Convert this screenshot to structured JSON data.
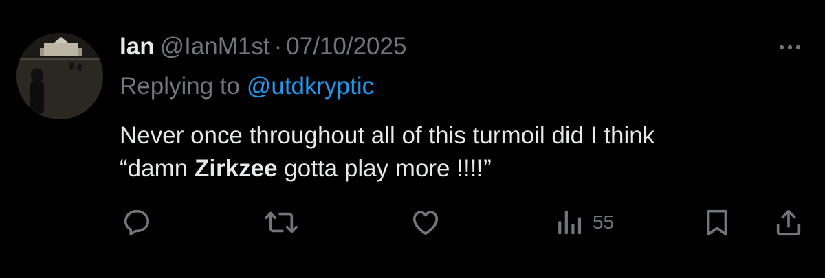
{
  "tweet": {
    "display_name": "Ian",
    "handle": "@IanM1st",
    "separator": "·",
    "date": "07/10/2025",
    "replying_prefix": "Replying to ",
    "replying_to": "@utdkryptic",
    "text_line1": "Never once throughout all of this turmoil did I think",
    "text_line2_before": "“damn ",
    "text_line2_bold": "Zirkzee",
    "text_line2_after": " gotta play more !!!!”"
  },
  "actions": {
    "views_count": "55"
  },
  "icons": {
    "more": "more-horizontal-icon",
    "reply": "reply-bubble-icon",
    "retweet": "retweet-icon",
    "like": "heart-icon",
    "views": "views-bar-chart-icon",
    "bookmark": "bookmark-icon",
    "share": "share-upload-icon"
  },
  "colors": {
    "background": "#000000",
    "primary_text": "#e7e9ea",
    "secondary_text": "#71767b",
    "link": "#1d9bf0",
    "divider": "#2f3336"
  }
}
